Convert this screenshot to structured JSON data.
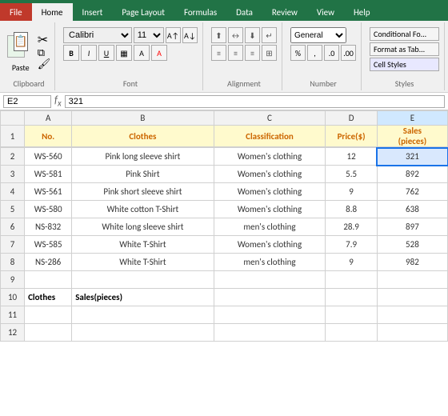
{
  "tabs": [
    "File",
    "Home",
    "Insert",
    "Page Layout",
    "Formulas",
    "Data",
    "Review",
    "View",
    "Help"
  ],
  "active_tab": "Home",
  "ribbon": {
    "groups": {
      "clipboard": "Clipboard",
      "font": "Font",
      "alignment": "Alignment",
      "number": "Number",
      "styles": "Styles"
    },
    "font_name": "Calibri",
    "font_size": "11",
    "format_label": "Format",
    "cell_styles_label": "Cell Styles",
    "conditional_formatting": "Conditional Fo...",
    "format_as_table": "Format as Tab..."
  },
  "formula_bar": {
    "cell_ref": "E2",
    "formula": "321"
  },
  "columns": [
    "A",
    "B",
    "C",
    "D",
    "E"
  ],
  "col_widths": [
    "50",
    "160",
    "130",
    "70",
    "80"
  ],
  "headers": {
    "row": "1",
    "no": "No.",
    "clothes": "Clothes",
    "classification": "Classification",
    "price": "Price($)",
    "sales": "Sales\n(pieces)"
  },
  "rows": [
    {
      "row": "2",
      "no": "WS-560",
      "clothes": "Pink long sleeve shirt",
      "classification": "Women's clothing",
      "price": "12",
      "sales": "321"
    },
    {
      "row": "3",
      "no": "WS-581",
      "clothes": "Pink Shirt",
      "classification": "Women's clothing",
      "price": "5.5",
      "sales": "892"
    },
    {
      "row": "4",
      "no": "WS-561",
      "clothes": "Pink short sleeve shirt",
      "classification": "Women's clothing",
      "price": "9",
      "sales": "762"
    },
    {
      "row": "5",
      "no": "WS-580",
      "clothes": "White cotton T-Shirt",
      "classification": "Women's clothing",
      "price": "8.8",
      "sales": "638"
    },
    {
      "row": "6",
      "no": "NS-832",
      "clothes": "White long sleeve shirt",
      "classification": "men's clothing",
      "price": "28.9",
      "sales": "897"
    },
    {
      "row": "7",
      "no": "WS-585",
      "clothes": "White T-Shirt",
      "classification": "Women's clothing",
      "price": "7.9",
      "sales": "528"
    },
    {
      "row": "8",
      "no": "NS-286",
      "clothes": "White T-Shirt",
      "classification": "men's clothing",
      "price": "9",
      "sales": "982"
    }
  ],
  "empty_rows": [
    "9",
    "11",
    "12"
  ],
  "row10": {
    "row": "10",
    "col_a": "Clothes",
    "col_b": "Sales(pieces)"
  }
}
